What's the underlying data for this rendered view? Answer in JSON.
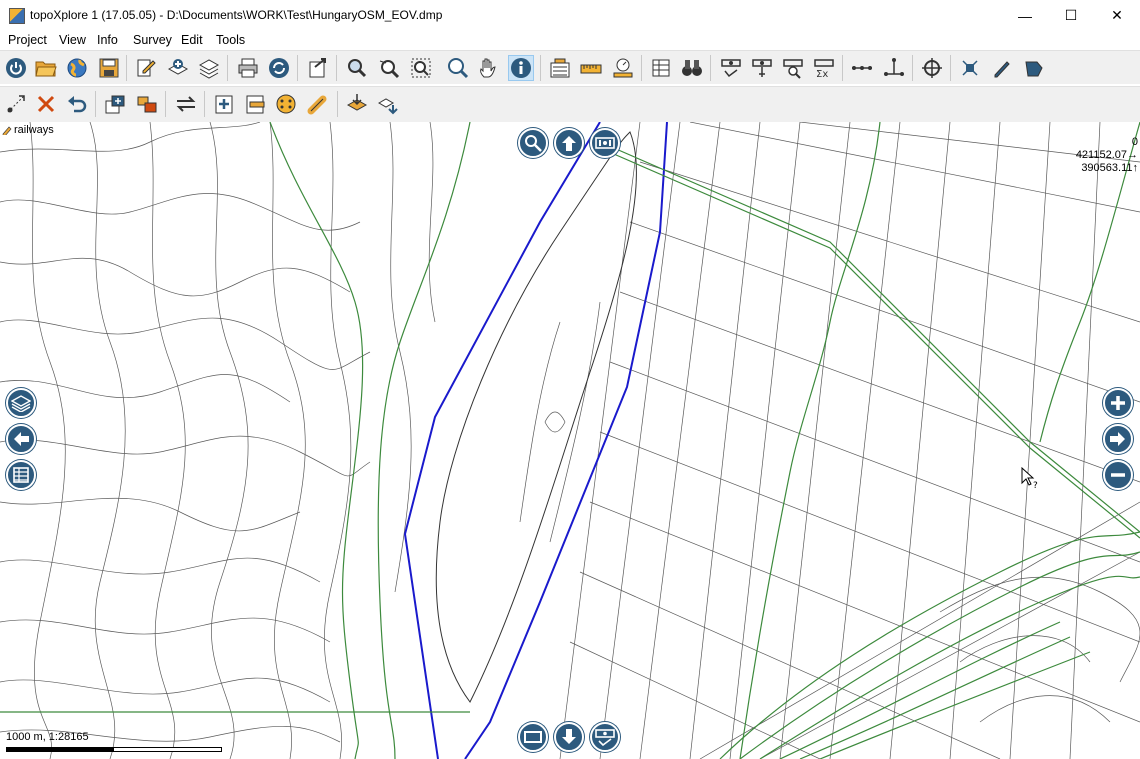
{
  "window": {
    "title": "topoXplore 1 (17.05.05) - D:\\Documents\\WORK\\Test\\HungaryOSM_EOV.dmp",
    "minimize": "—",
    "maximize": "☐",
    "close": "✕"
  },
  "menu": {
    "items": [
      {
        "label": "Project"
      },
      {
        "label": "View"
      },
      {
        "label": "Info"
      },
      {
        "label": "Survey"
      },
      {
        "label": "Edit"
      },
      {
        "label": "Tools"
      }
    ]
  },
  "toolbar1": {
    "buttons": [
      "power-icon",
      "open-folder-icon",
      "globe-icon",
      "save-icon",
      "edit-document-icon",
      "add-layer-icon",
      "layers-icon",
      "print-icon",
      "refresh-icon",
      "export-icon",
      "zoom-area-icon",
      "zoom-select-icon",
      "zoom-window-icon",
      "zoom-icon",
      "pan-hand-icon",
      "info-icon",
      "map-properties-icon",
      "ruler-icon",
      "measure-icon",
      "table-icon",
      "binoculars-icon",
      "survey-point-icon",
      "survey-edit-icon",
      "survey-search-icon",
      "survey-calc-icon",
      "line-tool-icon",
      "point-tool-icon",
      "target-icon",
      "node-icon",
      "pen-icon",
      "polygon-icon"
    ]
  },
  "toolbar2": {
    "buttons": [
      "pick-point-icon",
      "delete-icon",
      "undo-icon",
      "copy-layer-icon",
      "move-layer-icon",
      "swap-icon",
      "add-object-icon",
      "cut-object-icon",
      "merge-icon",
      "link-icon",
      "stack-layers-icon",
      "import-layers-icon"
    ]
  },
  "map": {
    "layer_label": "railways",
    "coord_top": "0",
    "coord_x": "421152.07",
    "coord_y": "390563.11",
    "scale_text": "1000 m, 1:28165",
    "colors": {
      "road": "#606060",
      "rail": "#3d8a3d",
      "river": "#1a1acc"
    }
  }
}
